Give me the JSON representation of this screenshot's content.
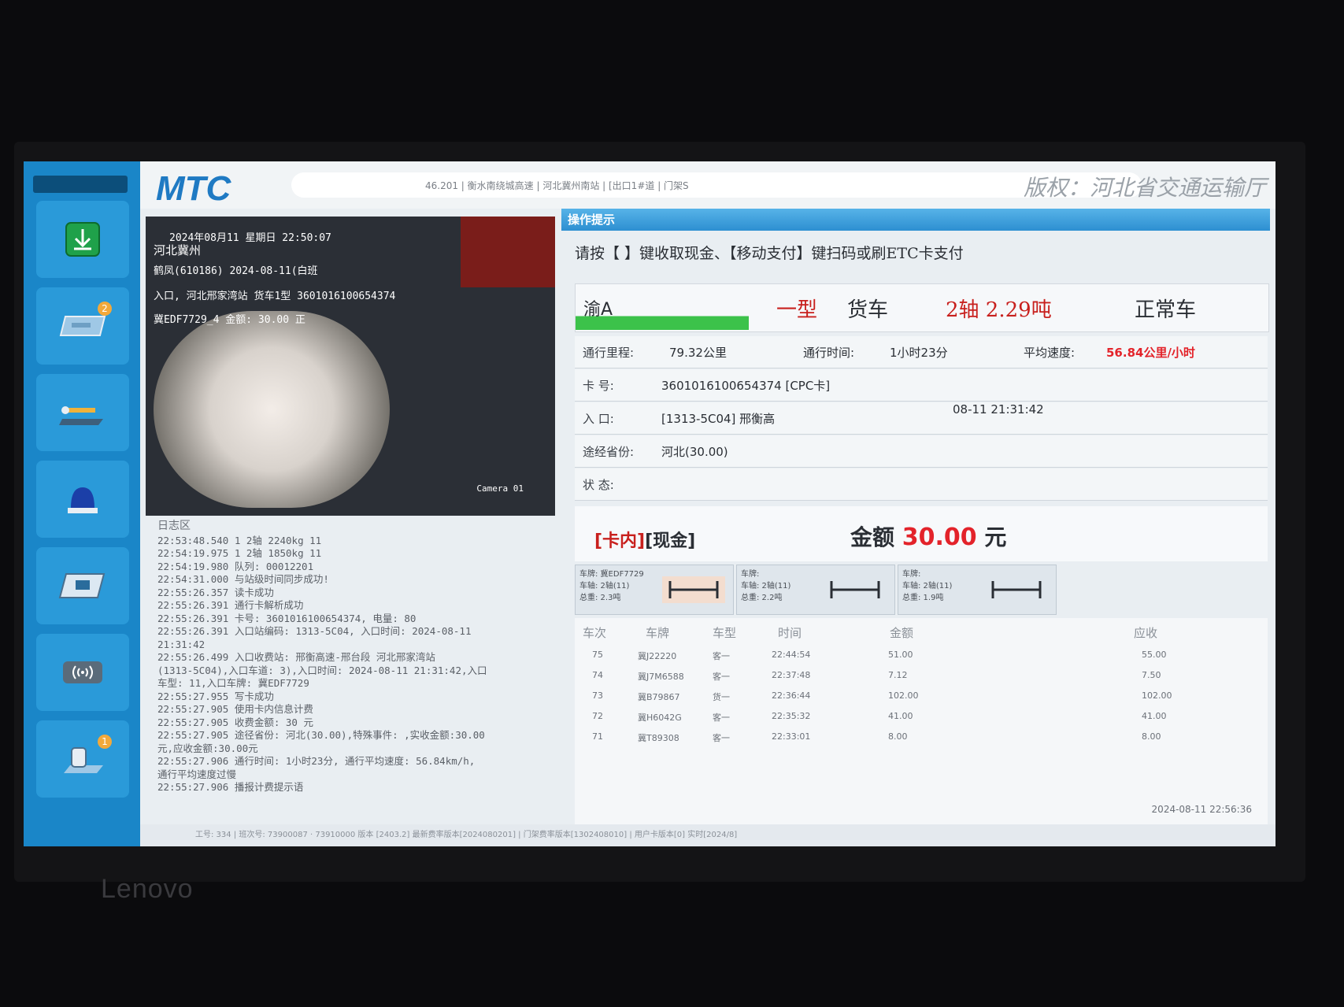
{
  "header": {
    "logo": "MTC",
    "info_bar": "46.201  |  衡水南绕城高速  |  河北冀州南站  |  [出口1#道  |  门架S",
    "copyright": "版权：河北省交通运输厅"
  },
  "sidebar": {
    "status_label": "",
    "items": [
      {
        "icon": "download-icon",
        "badge": ""
      },
      {
        "icon": "card-icon",
        "badge": "2"
      },
      {
        "icon": "barrier-icon",
        "badge": ""
      },
      {
        "icon": "alarm-light-icon",
        "badge": ""
      },
      {
        "icon": "card-reader-icon",
        "badge": ""
      },
      {
        "icon": "wireless-icon",
        "badge": ""
      },
      {
        "icon": "vehicle-icon",
        "badge": "1"
      }
    ]
  },
  "camera": {
    "overlay_lines": [
      "2024年08月11   星期日  22:50:07",
      "河北冀州",
      "鹤凤(610186) 2024-08-11(白班",
      "入口, 河北邢家湾站 货车1型 3601016100654374",
      "冀EDF7729_4 金额: 30.00 正"
    ],
    "camera_label": "Camera 01"
  },
  "log": {
    "title": "日志区",
    "lines": [
      "22:53:48.540 1     2轴    2240kg     11",
      "22:54:19.975 1     2轴    1850kg     11",
      "22:54:19.980 队列: 00012201",
      "22:54:31.000 与站级时间同步成功!",
      "22:55:26.357 读卡成功",
      "22:55:26.391 通行卡解析成功",
      "22:55:26.391 卡号: 3601016100654374, 电量: 80",
      "22:55:26.391 入口站编码: 1313-5C04, 入口时间: 2024-08-11",
      "21:31:42",
      "22:55:26.499 入口收费站: 邢衡高速-邢台段 河北邢家湾站",
      "(1313-5C04),入口车道: 3),入口时间: 2024-08-11 21:31:42,入口",
      "车型: 11,入口车牌: 冀EDF7729",
      "22:55:27.955 写卡成功",
      "22:55:27.905 使用卡内信息计费",
      "22:55:27.905 收费金额: 30 元",
      "22:55:27.905 途径省份: 河北(30.00),特殊事件: ,实收金额:30.00",
      "元,应收金额:30.00元",
      "22:55:27.906 通行时间: 1小时23分, 通行平均速度: 56.84km/h,",
      "通行平均速度过慢",
      "22:55:27.906 播报计费提示语"
    ]
  },
  "op_panel": {
    "title": "操作提示",
    "prompt": "请按【  】键收取现金、【移动支付】键扫码或刷ETC卡支付",
    "plate": "渝A",
    "vehicle_class": "一型",
    "vehicle_kind": "货车",
    "axle_weight": "2轴  2.29吨",
    "vehicle_status": "正常车",
    "mileage_label": "通行里程:",
    "mileage_value": "79.32公里",
    "duration_label": "通行时间:",
    "duration_value": "1小时23分",
    "speed_label": "平均速度:",
    "speed_value": "56.84公里/小时",
    "card_label": "卡    号:",
    "card_value": "3601016100654374 [CPC卡]",
    "entry_label": "入    口:",
    "entry_value": "[1313-5C04] 邢衡高",
    "entry_time": "08-11 21:31:42",
    "province_label": "途经省份:",
    "province_value": "河北(30.00)",
    "state_label": "状    态:",
    "state_value": "",
    "pay_flag_card": "[卡内]",
    "pay_flag_cash": "[现金]",
    "amount_label": "金额",
    "amount_value": "30.00",
    "amount_unit": "元"
  },
  "axle_cards": [
    {
      "line1": "车牌: 冀EDF7729",
      "line2": "车轴: 2轴(11)",
      "line3": "总重: 2.3吨"
    },
    {
      "line1": "车牌:",
      "line2": "车轴: 2轴(11)",
      "line3": "总重: 2.2吨"
    },
    {
      "line1": "车牌:",
      "line2": "车轴: 2轴(11)",
      "line3": "总重: 1.9吨"
    }
  ],
  "history": {
    "columns": [
      "车次",
      "车牌",
      "车型",
      "时间",
      "金额",
      "应收"
    ],
    "rows": [
      {
        "no": "75",
        "plate": "冀J22220",
        "type": "客一",
        "time": "22:44:54",
        "amount": "51.00",
        "due": "55.00"
      },
      {
        "no": "74",
        "plate": "冀J7M6588",
        "type": "客一",
        "time": "22:37:48",
        "amount": "7.12",
        "due": "7.50"
      },
      {
        "no": "73",
        "plate": "冀B79867",
        "type": "货一",
        "time": "22:36:44",
        "amount": "102.00",
        "due": "102.00"
      },
      {
        "no": "72",
        "plate": "冀H6042G",
        "type": "客一",
        "time": "22:35:32",
        "amount": "41.00",
        "due": "41.00"
      },
      {
        "no": "71",
        "plate": "冀T89308",
        "type": "客一",
        "time": "22:33:01",
        "amount": "8.00",
        "due": "8.00"
      }
    ],
    "clock": "2024-08-11  22:56:36"
  },
  "footer": {
    "status": "工号: 334 | 班次号: 73900087 · 73910000 版本  [2403.2]  最新费率版本[2024080201]  | 门架费率版本[1302408010]  | 用户卡版本[0]  实时[2024/8]",
    "line2": ""
  },
  "monitor": {
    "brand": "Lenovo"
  }
}
